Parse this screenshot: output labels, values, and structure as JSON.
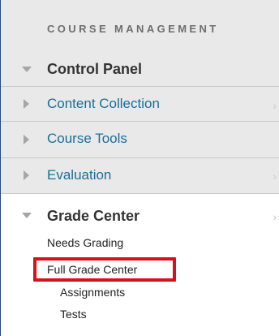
{
  "header": {
    "title": "COURSE MANAGEMENT"
  },
  "control_panel": {
    "label": "Control Panel"
  },
  "items": [
    {
      "label": "Content Collection"
    },
    {
      "label": "Course Tools"
    },
    {
      "label": "Evaluation"
    }
  ],
  "grade_center": {
    "label": "Grade Center",
    "sub_items": [
      {
        "label": "Needs Grading"
      },
      {
        "label": "Full Grade Center"
      },
      {
        "label": "Assignments"
      },
      {
        "label": "Tests"
      }
    ]
  },
  "colors": {
    "link": "#1b6e98",
    "highlight": "#d8101a",
    "panel_bg": "#e9e9e9"
  },
  "icons": {
    "expanded": "triangle-down-icon",
    "collapsed": "triangle-right-icon",
    "chevron": "chevron-right-icon"
  }
}
